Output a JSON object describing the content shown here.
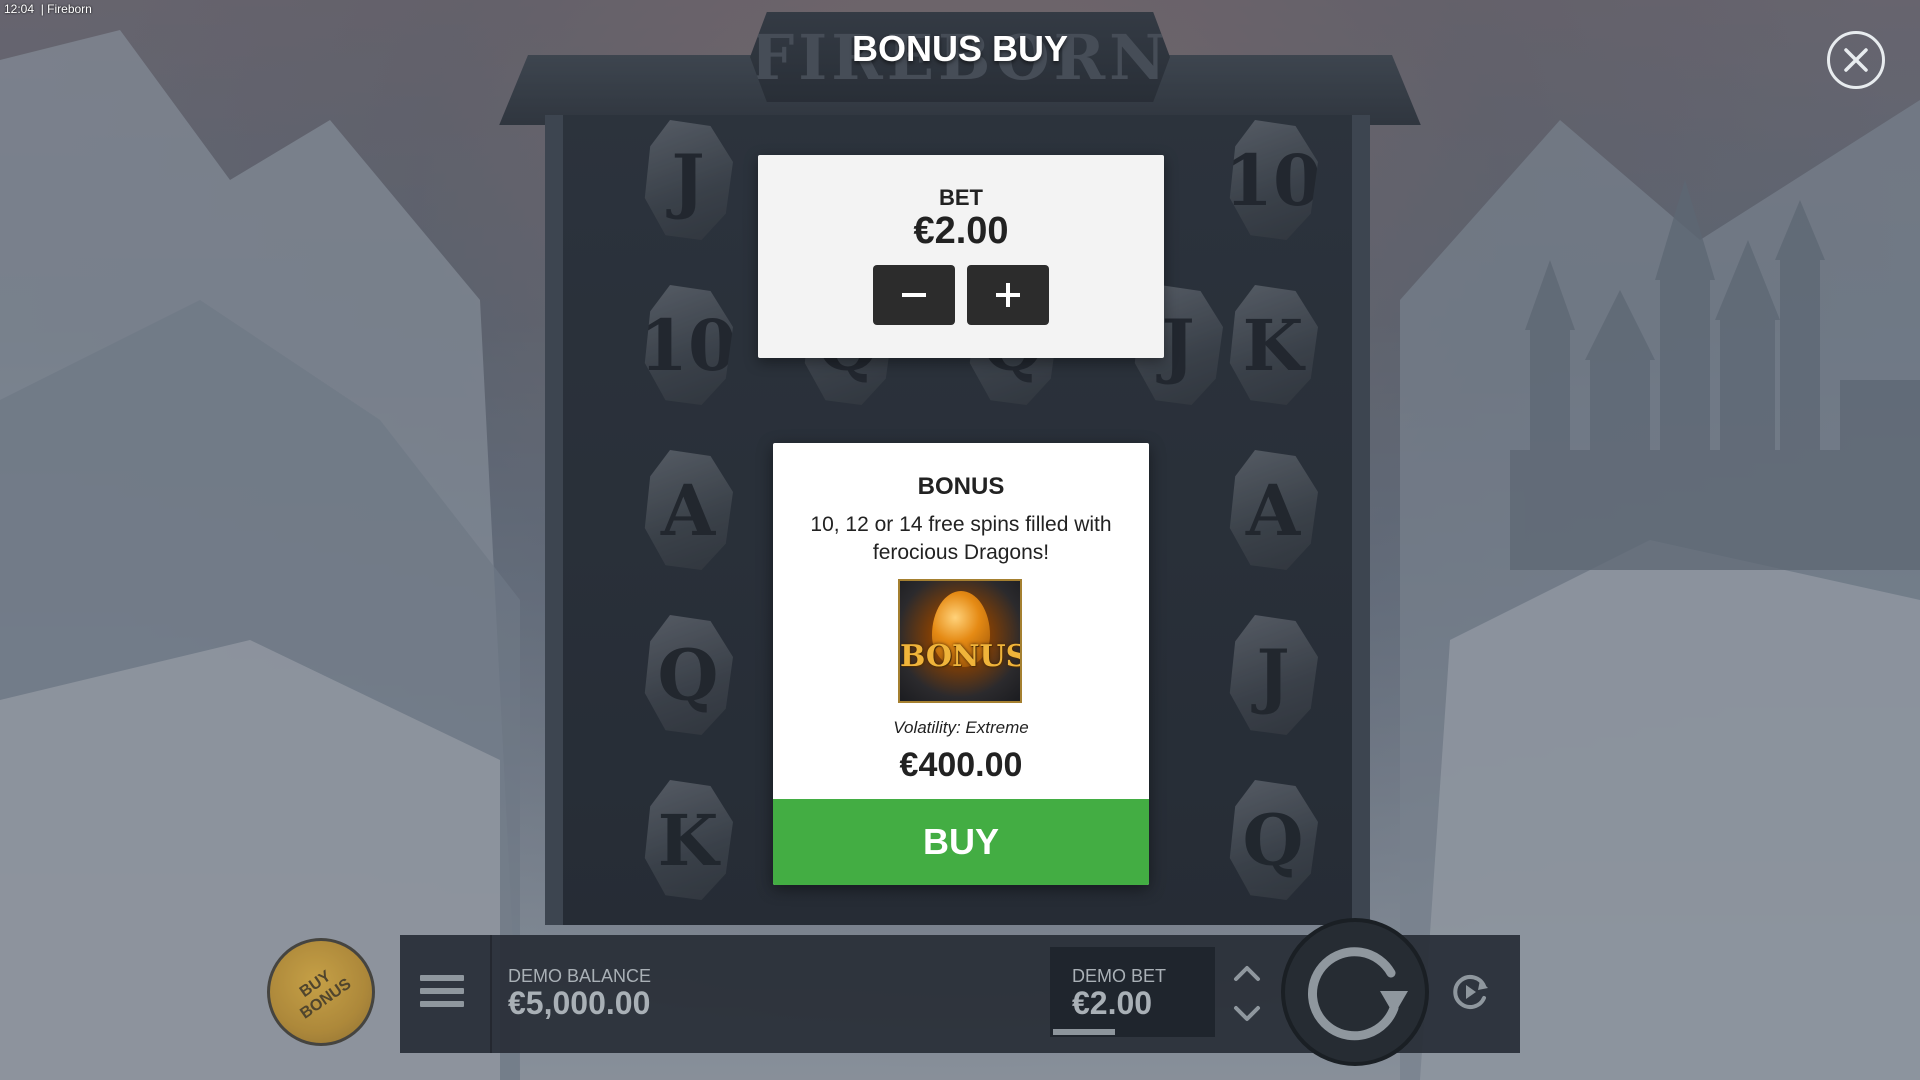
{
  "window": {
    "time": "12:04",
    "separator": "|",
    "app_name": "Fireborn"
  },
  "game": {
    "logo_text": "FIREBORN",
    "reel_symbols": [
      [
        "J",
        "10",
        "A",
        "Q",
        "K"
      ],
      [
        "",
        "Q",
        "",
        "",
        ""
      ],
      [
        "",
        "Q",
        "",
        "",
        ""
      ],
      [
        "",
        "J",
        "",
        "",
        ""
      ],
      [
        "10",
        "K",
        "A",
        "J",
        "Q"
      ]
    ]
  },
  "overlay": {
    "title": "BONUS BUY",
    "bet_card": {
      "label": "BET",
      "value": "€2.00"
    },
    "bonus_card": {
      "title": "BONUS",
      "description": "10, 12 or 14 free spins filled with ferocious Dragons!",
      "image_text": "BONUS",
      "volatility": "Volatility: Extreme",
      "price": "€400.00",
      "buy_label": "BUY"
    }
  },
  "bottom_bar": {
    "buy_bonus_label": "BUY BONUS",
    "balance_label": "DEMO BALANCE",
    "balance_value": "€5,000.00",
    "bet_label": "DEMO BET",
    "bet_value": "€2.00"
  },
  "icons": {
    "close": "close-icon",
    "minus": "minus-icon",
    "plus": "plus-icon",
    "menu": "menu-icon",
    "chevron_up": "chevron-up-icon",
    "chevron_down": "chevron-down-icon",
    "spin": "spin-icon",
    "autoplay": "autoplay-icon"
  },
  "colors": {
    "buy_button": "#43ad43",
    "card_background": "#ffffff",
    "stepper_button": "#2c2c2c"
  }
}
